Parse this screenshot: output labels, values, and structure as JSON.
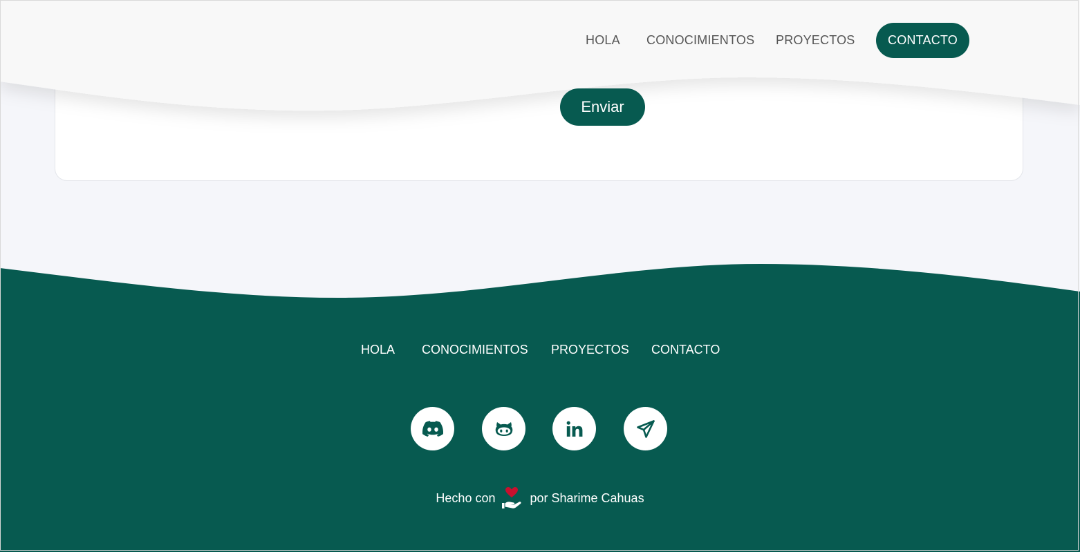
{
  "header": {
    "nav": [
      {
        "label": "HOLA"
      },
      {
        "label": "CONOCIMIENTOS"
      },
      {
        "label": "PROYECTOS"
      },
      {
        "label": "CONTACTO",
        "active": true
      }
    ]
  },
  "contact_form": {
    "submit_label": "Enviar"
  },
  "footer": {
    "nav": [
      {
        "label": "HOLA"
      },
      {
        "label": "CONOCIMIENTOS"
      },
      {
        "label": "PROYECTOS"
      },
      {
        "label": "CONTACTO"
      }
    ],
    "social": [
      {
        "icon": "discord-icon"
      },
      {
        "icon": "github-icon"
      },
      {
        "icon": "linkedin-icon"
      },
      {
        "icon": "telegram-icon"
      }
    ],
    "credit_prefix": "Hecho con",
    "credit_suffix": "por Sharime Cahuas"
  },
  "colors": {
    "primary": "#075a50",
    "header_bg": "#f8f8f8",
    "page_bg": "#f5f6fa",
    "heart": "#c8102e"
  }
}
